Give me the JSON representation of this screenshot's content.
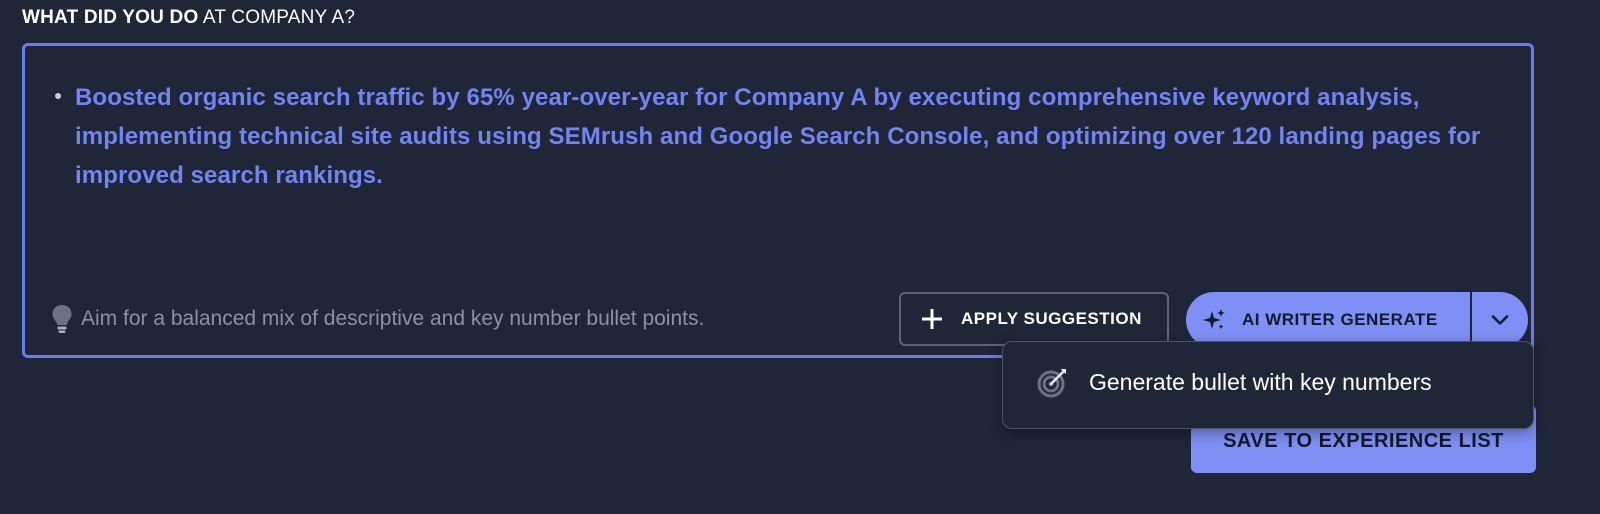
{
  "section": {
    "heading_bold": "WHAT DID YOU DO",
    "heading_rest": " AT COMPANY A?"
  },
  "editor": {
    "bullets": [
      "Boosted organic search traffic by 65% year-over-year for Company A by executing comprehensive keyword analysis, implementing technical site audits using SEMrush and Google Search Console, and optimizing over 120 landing pages for improved search rankings."
    ],
    "tip_icon": "lightbulb-icon",
    "tip_text": "Aim for a balanced mix of descriptive and key number bullet points."
  },
  "actions": {
    "apply_icon": "plus-icon",
    "apply_label": "APPLY SUGGESTION",
    "ai_icon": "sparkle-icon",
    "ai_label": "AI WRITER GENERATE",
    "ai_caret_icon": "chevron-down-icon",
    "save_label": "SAVE TO EXPERIENCE LIST"
  },
  "dropdown": {
    "items": [
      {
        "icon": "target-icon",
        "label": "Generate bullet with key numbers"
      }
    ]
  },
  "colors": {
    "background": "#1e2638",
    "accent": "#7f8ff5",
    "bullet_text": "#7384f2",
    "editor_border": "#6a7bef",
    "muted_text": "#8a92a6"
  }
}
